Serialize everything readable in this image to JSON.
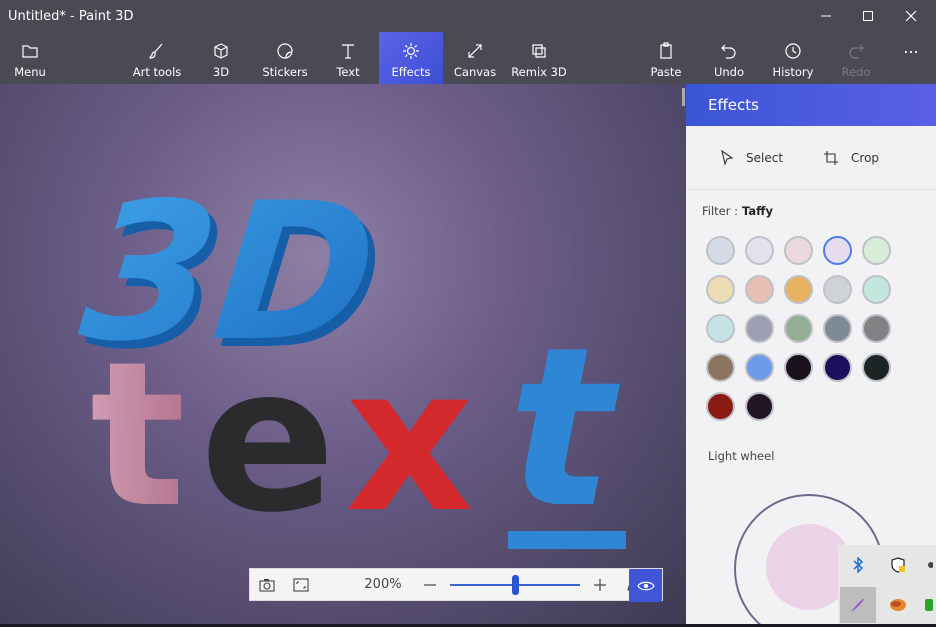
{
  "window": {
    "title": "Untitled* - Paint 3D"
  },
  "toolbar": {
    "menu": "Menu",
    "art_tools": "Art tools",
    "three_d": "3D",
    "stickers": "Stickers",
    "text": "Text",
    "effects": "Effects",
    "canvas": "Canvas",
    "remix": "Remix 3D",
    "paste": "Paste",
    "undo": "Undo",
    "history": "History",
    "redo": "Redo",
    "more": "..."
  },
  "canvas_art": {
    "heading": "3D",
    "word": "text"
  },
  "zoom": {
    "percent": "200%",
    "level": 0.5
  },
  "panel": {
    "title": "Effects",
    "select": "Select",
    "crop": "Crop",
    "filter_label": "Filter :",
    "filter_value": "Taffy",
    "light_wheel": "Light wheel",
    "swatches": [
      [
        "#d5dbe5",
        "#e3e1ee",
        "#ecd9df",
        "#e8dcef",
        "#d7edd8"
      ],
      [
        "#ecdcb3",
        "#e8bfb4",
        "#e6b260",
        "#cfd3d6",
        "#c3e6dd"
      ],
      [
        "#c5e3e6",
        "#9c9eb3",
        "#94ad95",
        "#7e8b96",
        "#808284"
      ],
      [
        "#8c745f",
        "#6f9ae8",
        "#19111d",
        "#1d0f5c",
        "#1c2424"
      ],
      [
        "#8a1a12",
        "#231526"
      ]
    ],
    "selected_swatch": "#e8dcef"
  }
}
